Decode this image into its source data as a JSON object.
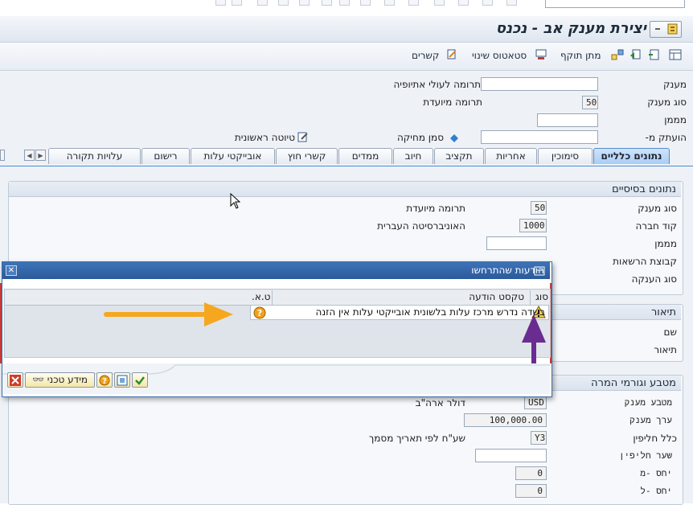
{
  "window": {
    "title": "יצירת מענק אב - נכנס"
  },
  "toolbar": {
    "items": [
      {
        "label": "מתן תוקף"
      },
      {
        "label": "סטאטוס שינוי"
      },
      {
        "label": "קשרים"
      }
    ]
  },
  "header": {
    "grant_label": "מענק",
    "grant_value": "",
    "type_label": "סוג מענק",
    "type_value": "50",
    "type_desc": "תרומה מיועדת",
    "sponsor_label": "מממן",
    "sponsor_value": "",
    "copy_label": "הועתק מ-",
    "copy_value": "",
    "subtitle": "תרומה לעולי אתיופיה",
    "delete_flag": "סמן מחיקה",
    "draft": "טיוטה ראשונית"
  },
  "tabs": [
    {
      "label": "נתונים כלליים"
    },
    {
      "label": "סימוכין"
    },
    {
      "label": "אחריות"
    },
    {
      "label": "תקציב"
    },
    {
      "label": "חיוב"
    },
    {
      "label": "ממדים"
    },
    {
      "label": "קשרי חוץ"
    },
    {
      "label": "אובייקטי עלות"
    },
    {
      "label": "רישום"
    },
    {
      "label": "עלויות תקורה"
    }
  ],
  "basic": {
    "title": "נתונים בסיסיים",
    "type_label": "סוג מענק",
    "type_value": "50",
    "type_desc": "תרומה מיועדת",
    "company_label": "קוד חברה",
    "company_value": "1000",
    "company_desc": "האוניברסיטה העברית",
    "sponsor_label": "מממן",
    "sponsor_value": "",
    "authgroup_label": "קבוצת הרשאות",
    "grant_kind_label": "סוג הענקה"
  },
  "description": {
    "title": "תיאור",
    "name_label": "שם",
    "desc_label": "תיאור"
  },
  "currency": {
    "title": "מטבע וגורמי המרה",
    "currency_label": "מטבע מענק",
    "currency_value": "USD",
    "currency_desc": "דולר ארה\"ב",
    "value_label": "ערך מענק",
    "value_value": "100,000.00",
    "rule_label": "כלל חליפין",
    "rule_value": "Y3",
    "rule_desc": "שע\"ח לפי תאריך מסמך",
    "rate_label": "שער חליפין",
    "rate_value": "",
    "from_label": "יחס -מ",
    "from_value": "0",
    "to_label": "יחס -ל",
    "to_value": "0"
  },
  "dialog": {
    "title": "הודעות שהתרחשו",
    "col_type": "סוג",
    "col_text": "טקסט הודעה",
    "col_ltx": "ט.א.",
    "message": "בשדה נדרש מרכז עלות בלשונית אובייקטי עלות אין הזנה",
    "tech_info": "מידע טכני"
  },
  "colors": {
    "accent_blue": "#4f8ccd",
    "dialog_title": "#2b5a9b",
    "arrow_orange": "#f5a81f",
    "arrow_purple": "#6a2c91"
  }
}
